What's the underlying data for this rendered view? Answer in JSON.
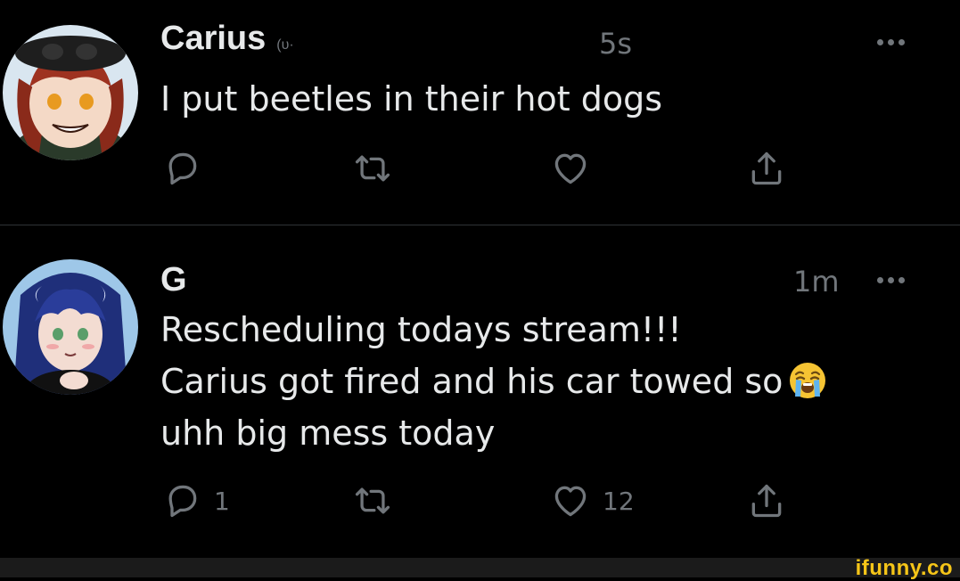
{
  "tweets": [
    {
      "display_name": "Carius",
      "handle": "(ᴜ·",
      "timestamp": "5s",
      "lines": [
        "I put beetles in their hot dogs"
      ],
      "reply_count": "",
      "retweet_count": "",
      "like_count": ""
    },
    {
      "display_name": "G",
      "handle": "",
      "timestamp": "1m",
      "lines": [
        "Rescheduling todays stream!!!",
        "Carius got fired and his car towed so",
        "uhh big mess today"
      ],
      "reply_count": "1",
      "retweet_count": "",
      "like_count": "12"
    }
  ],
  "icons": {
    "reply": "reply-icon",
    "retweet": "retweet-icon",
    "like": "heart-icon",
    "share": "share-icon",
    "more": "more-icon",
    "emoji": "loudly-crying-face-emoji"
  },
  "colors": {
    "background": "#000000",
    "text": "#e7e9ea",
    "muted": "#71767b",
    "divider": "#2f3336",
    "watermark": "#f5c518"
  },
  "watermark": "ifunny.co"
}
